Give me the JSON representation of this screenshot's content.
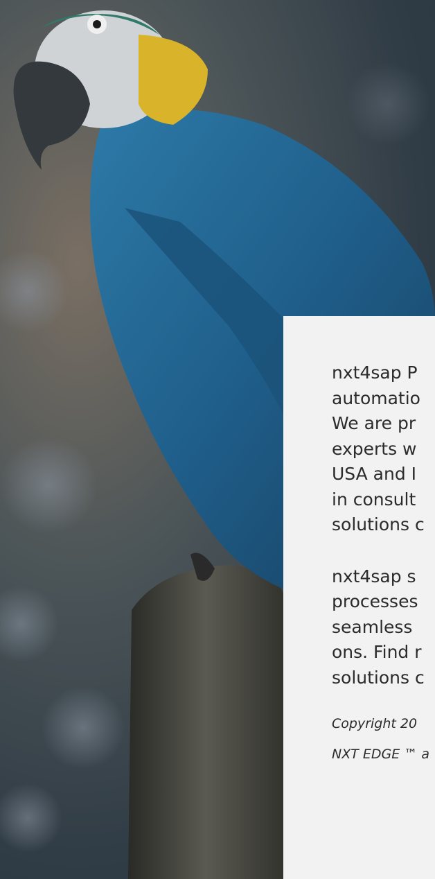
{
  "hero": {
    "image_name": "parrot-photo"
  },
  "about": {
    "paragraph_1_lines": [
      "nxt4sap P",
      "automatio",
      "We are pr",
      "experts w",
      "USA and I",
      "in consult",
      "solutions c"
    ],
    "paragraph_2_lines": [
      "nxt4sap s",
      "processes",
      "seamless",
      "ons. Find r",
      "solutions c"
    ]
  },
  "footer": {
    "copyright_line": "Copyright 20",
    "trademark_line": "NXT EDGE ™ a"
  },
  "colors": {
    "card_bg": "#f2f2f2",
    "text": "#2b2b2b"
  }
}
